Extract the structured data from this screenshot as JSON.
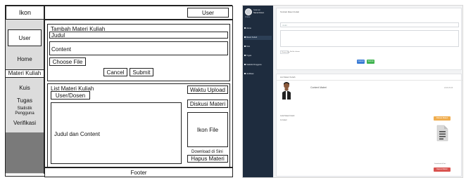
{
  "wireframe": {
    "icon_label": "Ikon",
    "top_user_label": "User",
    "sidebar_user_label": "User",
    "nav": [
      "Home",
      "Materi Kuliah",
      "Kuis",
      "Tugas",
      "Statistik Pengguna",
      "Verifikasi"
    ],
    "active_nav": "Materi Kuliah",
    "form": {
      "title": "Tambah Materi Kuliah",
      "judul_label": "Judul",
      "content_label": "Content",
      "choose_file_label": "Choose File",
      "cancel_label": "Cancel",
      "submit_label": "Submit"
    },
    "list": {
      "title": "List Materi Kuliah",
      "user_dosen_label": "User/Dosen",
      "judul_content_label": "Judul dan Content",
      "waktu_upload_label": "Waktu Upload",
      "diskusi_label": "Diskusi Materi",
      "ikon_file_label": "Ikon File",
      "download_label": "Download di Sini",
      "hapus_label": "Hapus Materi"
    },
    "footer_label": "Footer"
  },
  "screenshot": {
    "sidebar": {
      "user_line1": "Selamat",
      "user_line2": "Nama Dosen",
      "role": "Online",
      "menu": [
        "Home",
        "Materi Kuliah",
        "Kuis",
        "Tugas",
        "Statistik Pengguna",
        "Verifikasi"
      ],
      "active_index": 1
    },
    "form": {
      "title": "Tambah Materi Kuliah",
      "judul_placeholder": "Judul",
      "choose_file_label": "Choose File",
      "no_file_label": "No file chosen",
      "cancel_label": "Cancel",
      "submit_label": "Submit"
    },
    "list": {
      "title": "List Materi Kuliah",
      "content_label": "Content Materi",
      "date_label": "2018-05-09",
      "judul_label": "Judul Materi Kuliah",
      "content_small": "Isi materi",
      "diskusi_label": "Diskusi Materi",
      "download_label": "Download di Sini",
      "hapus_label": "Hapus Materi"
    },
    "colors": {
      "sidebar": "#1e2c3e",
      "cancel_button": "#3a7bd5",
      "submit_button": "#3fb34f",
      "diskusi_button": "#f0ad4e",
      "hapus_button": "#d9534f"
    }
  }
}
